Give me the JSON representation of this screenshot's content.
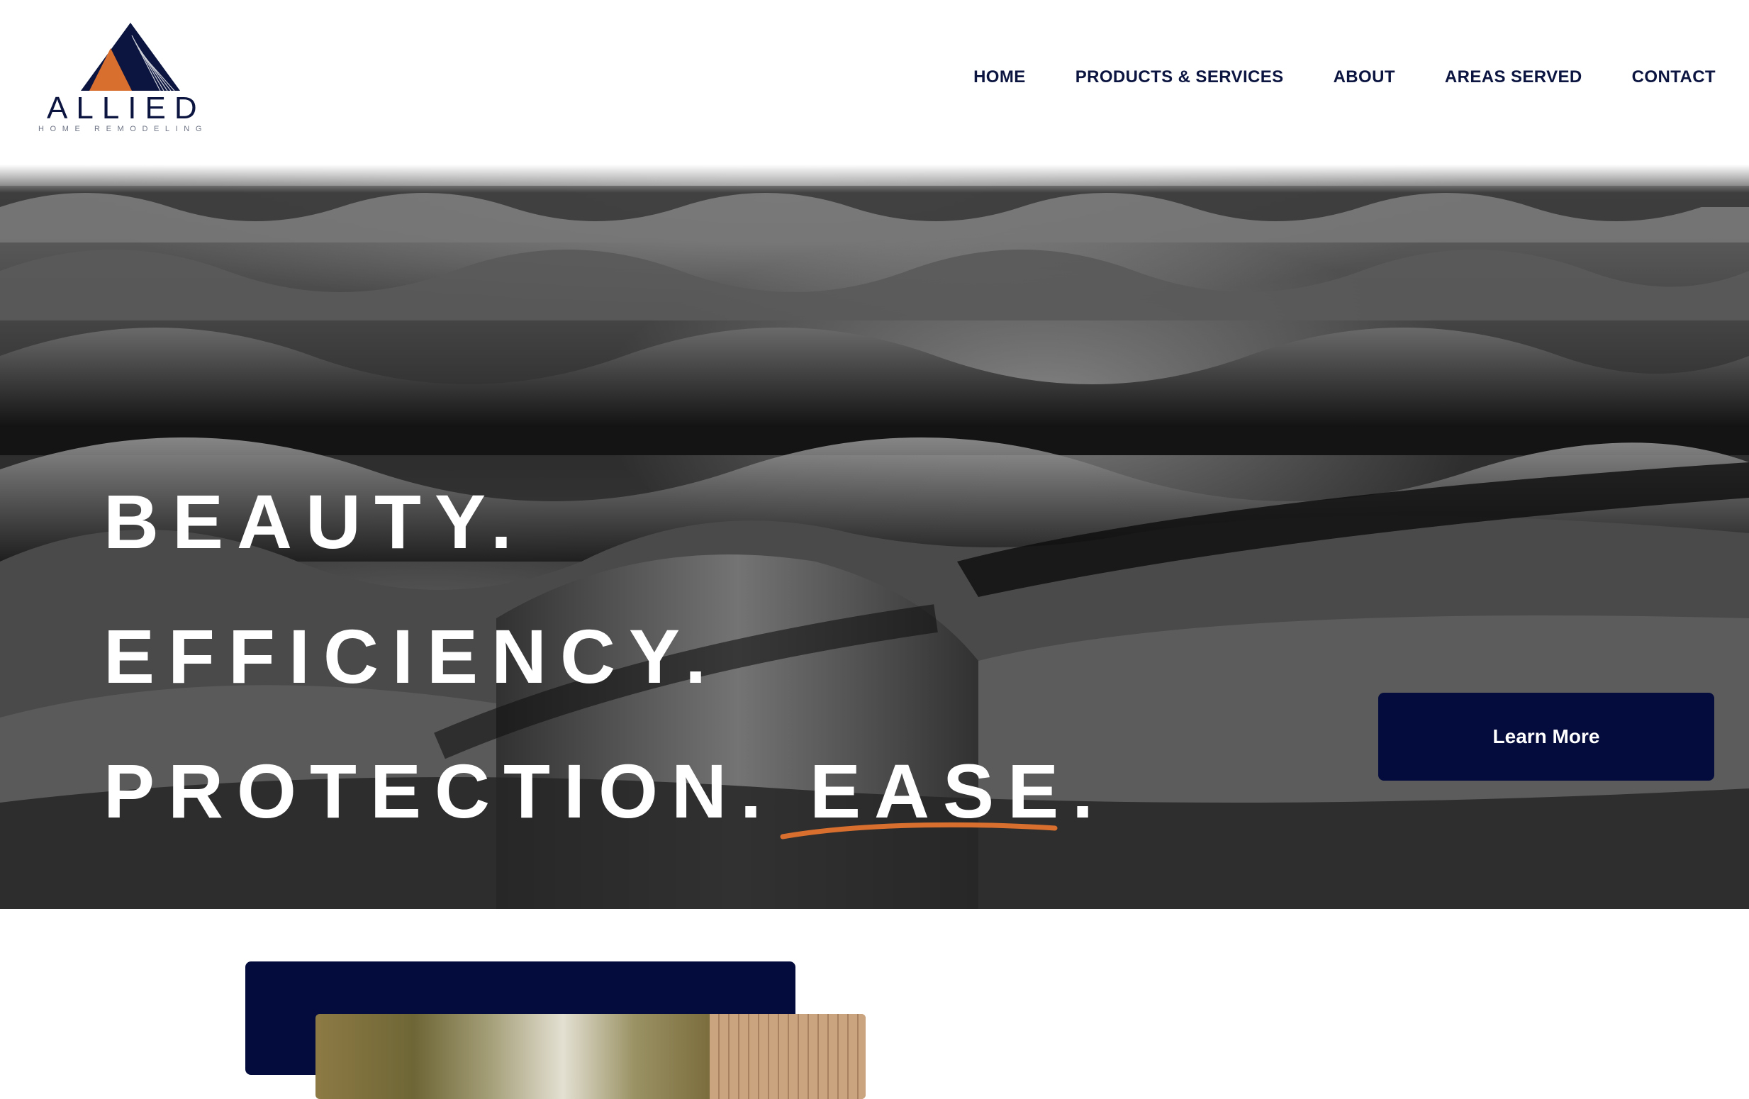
{
  "brand": {
    "name": "ALLIED",
    "tagline": "HOME REMODELING",
    "colors": {
      "navy": "#0b1540",
      "orange": "#d86f2f",
      "button": "#040c3d"
    }
  },
  "nav": {
    "items": [
      {
        "label": "HOME"
      },
      {
        "label": "PRODUCTS & SERVICES"
      },
      {
        "label": "ABOUT"
      },
      {
        "label": "AREAS SERVED"
      },
      {
        "label": "CONTACT"
      }
    ]
  },
  "hero": {
    "line1": "BEAUTY.",
    "line2": "EFFICIENCY.",
    "line3": "PROTECTION. EASE.",
    "cta_label": "Learn More",
    "background": "roof-tiles-photo"
  }
}
